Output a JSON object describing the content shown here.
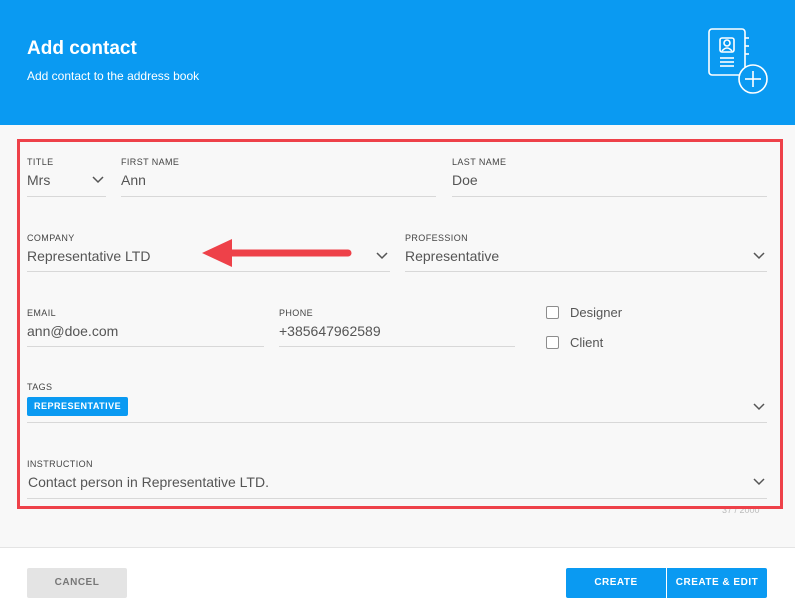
{
  "header": {
    "title": "Add contact",
    "subtitle": "Add contact to the address book",
    "icon": "address-book-add-icon",
    "color": "#0a9af2"
  },
  "form": {
    "title_field": {
      "label": "TITLE",
      "value": "Mrs"
    },
    "first_name": {
      "label": "FIRST NAME",
      "value": "Ann"
    },
    "last_name": {
      "label": "LAST NAME",
      "value": "Doe"
    },
    "company": {
      "label": "COMPANY",
      "value": "Representative LTD"
    },
    "profession": {
      "label": "PROFESSION",
      "value": "Representative"
    },
    "email": {
      "label": "EMAIL",
      "value": "ann@doe.com"
    },
    "phone": {
      "label": "PHONE",
      "value": "+385647962589"
    },
    "checkboxes": [
      {
        "label": "Designer",
        "checked": false
      },
      {
        "label": "Client",
        "checked": false
      }
    ],
    "tags": {
      "label": "TAGS",
      "items": [
        "REPRESENTATIVE"
      ]
    },
    "instruction": {
      "label": "INSTRUCTION",
      "value": "Contact person in Representative LTD.",
      "counter": "37 / 2000"
    }
  },
  "annotation": {
    "highlight_color": "#ee4149"
  },
  "footer": {
    "cancel": "CANCEL",
    "create": "CREATE",
    "create_edit": "CREATE & EDIT"
  }
}
